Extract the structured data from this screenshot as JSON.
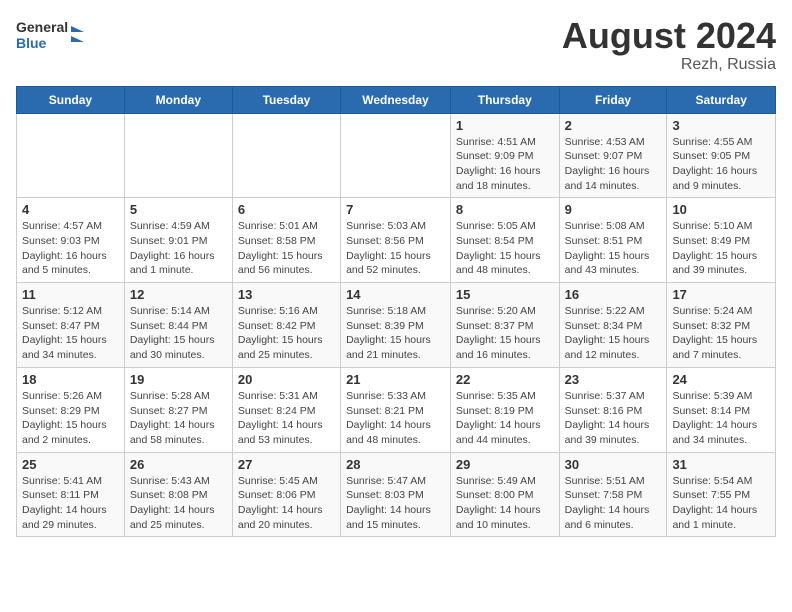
{
  "header": {
    "logo_line1": "General",
    "logo_line2": "Blue",
    "month_year": "August 2024",
    "location": "Rezh, Russia"
  },
  "weekdays": [
    "Sunday",
    "Monday",
    "Tuesday",
    "Wednesday",
    "Thursday",
    "Friday",
    "Saturday"
  ],
  "weeks": [
    [
      {
        "day": "",
        "info": ""
      },
      {
        "day": "",
        "info": ""
      },
      {
        "day": "",
        "info": ""
      },
      {
        "day": "",
        "info": ""
      },
      {
        "day": "1",
        "info": "Sunrise: 4:51 AM\nSunset: 9:09 PM\nDaylight: 16 hours\nand 18 minutes."
      },
      {
        "day": "2",
        "info": "Sunrise: 4:53 AM\nSunset: 9:07 PM\nDaylight: 16 hours\nand 14 minutes."
      },
      {
        "day": "3",
        "info": "Sunrise: 4:55 AM\nSunset: 9:05 PM\nDaylight: 16 hours\nand 9 minutes."
      }
    ],
    [
      {
        "day": "4",
        "info": "Sunrise: 4:57 AM\nSunset: 9:03 PM\nDaylight: 16 hours\nand 5 minutes."
      },
      {
        "day": "5",
        "info": "Sunrise: 4:59 AM\nSunset: 9:01 PM\nDaylight: 16 hours\nand 1 minute."
      },
      {
        "day": "6",
        "info": "Sunrise: 5:01 AM\nSunset: 8:58 PM\nDaylight: 15 hours\nand 56 minutes."
      },
      {
        "day": "7",
        "info": "Sunrise: 5:03 AM\nSunset: 8:56 PM\nDaylight: 15 hours\nand 52 minutes."
      },
      {
        "day": "8",
        "info": "Sunrise: 5:05 AM\nSunset: 8:54 PM\nDaylight: 15 hours\nand 48 minutes."
      },
      {
        "day": "9",
        "info": "Sunrise: 5:08 AM\nSunset: 8:51 PM\nDaylight: 15 hours\nand 43 minutes."
      },
      {
        "day": "10",
        "info": "Sunrise: 5:10 AM\nSunset: 8:49 PM\nDaylight: 15 hours\nand 39 minutes."
      }
    ],
    [
      {
        "day": "11",
        "info": "Sunrise: 5:12 AM\nSunset: 8:47 PM\nDaylight: 15 hours\nand 34 minutes."
      },
      {
        "day": "12",
        "info": "Sunrise: 5:14 AM\nSunset: 8:44 PM\nDaylight: 15 hours\nand 30 minutes."
      },
      {
        "day": "13",
        "info": "Sunrise: 5:16 AM\nSunset: 8:42 PM\nDaylight: 15 hours\nand 25 minutes."
      },
      {
        "day": "14",
        "info": "Sunrise: 5:18 AM\nSunset: 8:39 PM\nDaylight: 15 hours\nand 21 minutes."
      },
      {
        "day": "15",
        "info": "Sunrise: 5:20 AM\nSunset: 8:37 PM\nDaylight: 15 hours\nand 16 minutes."
      },
      {
        "day": "16",
        "info": "Sunrise: 5:22 AM\nSunset: 8:34 PM\nDaylight: 15 hours\nand 12 minutes."
      },
      {
        "day": "17",
        "info": "Sunrise: 5:24 AM\nSunset: 8:32 PM\nDaylight: 15 hours\nand 7 minutes."
      }
    ],
    [
      {
        "day": "18",
        "info": "Sunrise: 5:26 AM\nSunset: 8:29 PM\nDaylight: 15 hours\nand 2 minutes."
      },
      {
        "day": "19",
        "info": "Sunrise: 5:28 AM\nSunset: 8:27 PM\nDaylight: 14 hours\nand 58 minutes."
      },
      {
        "day": "20",
        "info": "Sunrise: 5:31 AM\nSunset: 8:24 PM\nDaylight: 14 hours\nand 53 minutes."
      },
      {
        "day": "21",
        "info": "Sunrise: 5:33 AM\nSunset: 8:21 PM\nDaylight: 14 hours\nand 48 minutes."
      },
      {
        "day": "22",
        "info": "Sunrise: 5:35 AM\nSunset: 8:19 PM\nDaylight: 14 hours\nand 44 minutes."
      },
      {
        "day": "23",
        "info": "Sunrise: 5:37 AM\nSunset: 8:16 PM\nDaylight: 14 hours\nand 39 minutes."
      },
      {
        "day": "24",
        "info": "Sunrise: 5:39 AM\nSunset: 8:14 PM\nDaylight: 14 hours\nand 34 minutes."
      }
    ],
    [
      {
        "day": "25",
        "info": "Sunrise: 5:41 AM\nSunset: 8:11 PM\nDaylight: 14 hours\nand 29 minutes."
      },
      {
        "day": "26",
        "info": "Sunrise: 5:43 AM\nSunset: 8:08 PM\nDaylight: 14 hours\nand 25 minutes."
      },
      {
        "day": "27",
        "info": "Sunrise: 5:45 AM\nSunset: 8:06 PM\nDaylight: 14 hours\nand 20 minutes."
      },
      {
        "day": "28",
        "info": "Sunrise: 5:47 AM\nSunset: 8:03 PM\nDaylight: 14 hours\nand 15 minutes."
      },
      {
        "day": "29",
        "info": "Sunrise: 5:49 AM\nSunset: 8:00 PM\nDaylight: 14 hours\nand 10 minutes."
      },
      {
        "day": "30",
        "info": "Sunrise: 5:51 AM\nSunset: 7:58 PM\nDaylight: 14 hours\nand 6 minutes."
      },
      {
        "day": "31",
        "info": "Sunrise: 5:54 AM\nSunset: 7:55 PM\nDaylight: 14 hours\nand 1 minute."
      }
    ]
  ]
}
